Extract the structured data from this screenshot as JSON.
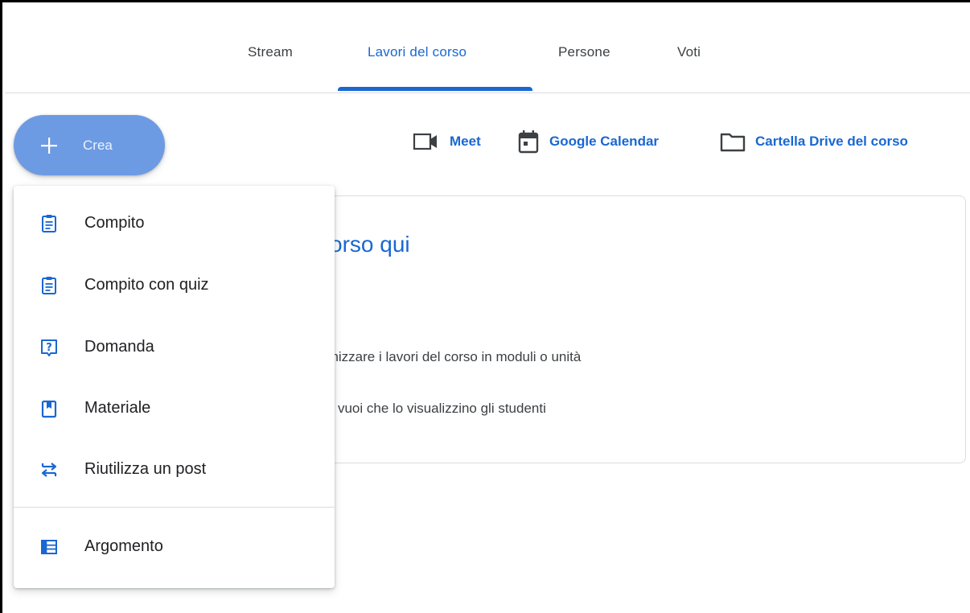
{
  "tabs": [
    {
      "label": "Stream",
      "active": false
    },
    {
      "label": "Lavori del corso",
      "active": true
    },
    {
      "label": "Persone",
      "active": false
    },
    {
      "label": "Voti",
      "active": false
    }
  ],
  "create_button": {
    "label": "Crea",
    "icon": "plus-icon"
  },
  "links": [
    {
      "label": "Meet",
      "icon": "video-camera-icon"
    },
    {
      "label": "Google Calendar",
      "icon": "calendar-icon"
    },
    {
      "label": "Cartella Drive del corso",
      "icon": "folder-icon"
    }
  ],
  "card": {
    "heading": "orso qui",
    "line1": "anizzare i lavori del corso in moduli o unità",
    "line2": "ui vuoi che lo visualizzino gli studenti"
  },
  "menu": {
    "items": [
      {
        "label": "Compito",
        "icon": "assignment-icon"
      },
      {
        "label": "Compito con quiz",
        "icon": "quiz-assignment-icon"
      },
      {
        "label": "Domanda",
        "icon": "question-icon"
      },
      {
        "label": "Materiale",
        "icon": "material-icon"
      },
      {
        "label": "Riutilizza un post",
        "icon": "repost-icon"
      },
      {
        "label": "Argomento",
        "icon": "topic-icon"
      }
    ]
  },
  "colors": {
    "accent": "#1967d2",
    "create_button_bg": "#6d9be3",
    "text": "#202124",
    "divider": "#dadce0"
  }
}
